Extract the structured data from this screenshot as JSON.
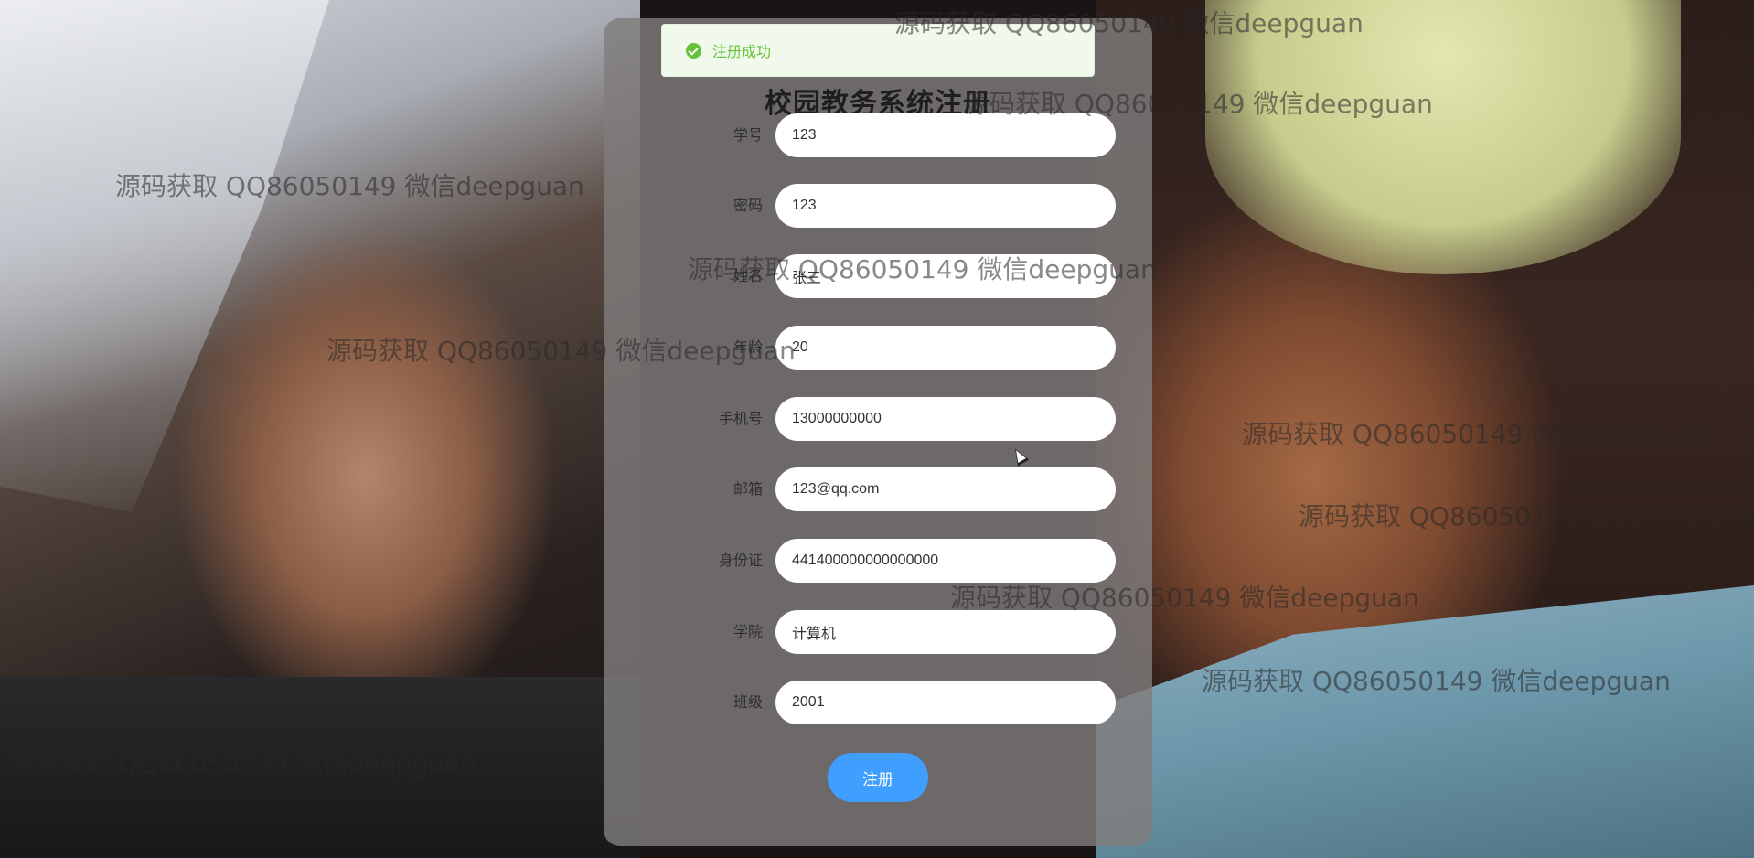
{
  "form": {
    "title": "校园教务系统注册",
    "fields": [
      {
        "label": "学号",
        "value": "123"
      },
      {
        "label": "密码",
        "value": "123"
      },
      {
        "label": "姓名",
        "value": "张三"
      },
      {
        "label": "年龄",
        "value": "20"
      },
      {
        "label": "手机号",
        "value": "13000000000"
      },
      {
        "label": "邮箱",
        "value": "123@qq.com"
      },
      {
        "label": "身份证",
        "value": "441400000000000000"
      },
      {
        "label": "学院",
        "value": "计算机"
      },
      {
        "label": "班级",
        "value": "2001"
      }
    ],
    "submit_label": "注册"
  },
  "toast": {
    "message": "注册成功",
    "icon": "check-circle-icon",
    "color": "#67c23a"
  },
  "watermark": {
    "text": "源码获取 QQ86050149 微信deepguan"
  },
  "colors": {
    "accent": "#409eff",
    "success": "#67c23a"
  }
}
